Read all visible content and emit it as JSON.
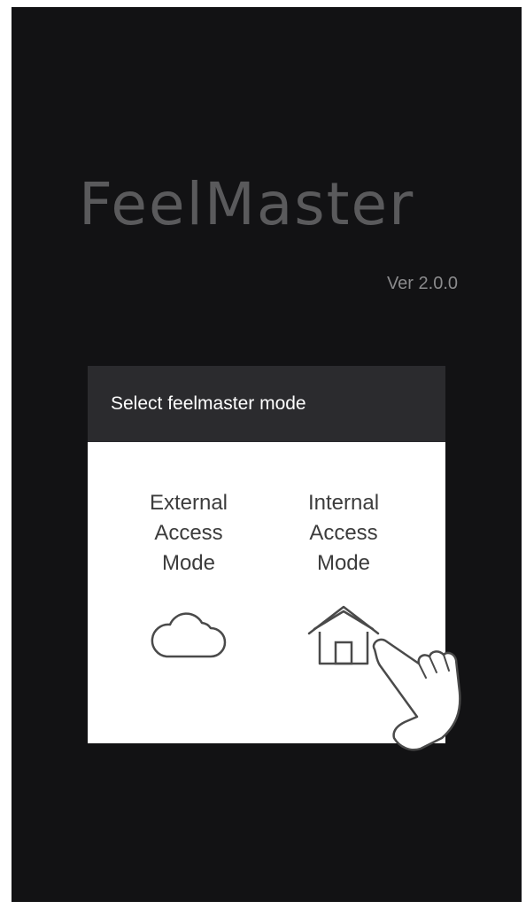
{
  "app": {
    "logo_text": "FeelMaster",
    "version": "Ver 2.0.0"
  },
  "dialog": {
    "title": "Select feelmaster mode",
    "options": [
      {
        "label_lines": [
          "External",
          "Access",
          "Mode"
        ],
        "icon": "cloud-icon"
      },
      {
        "label_lines": [
          "Internal",
          "Access",
          "Mode"
        ],
        "icon": "home-icon"
      }
    ]
  },
  "overlay": {
    "icon": "pointing-hand-icon"
  },
  "colors": {
    "background": "#121214",
    "dialog_header": "#2b2b2e",
    "dialog_body": "#ffffff",
    "logo": "#5a5a5c"
  }
}
